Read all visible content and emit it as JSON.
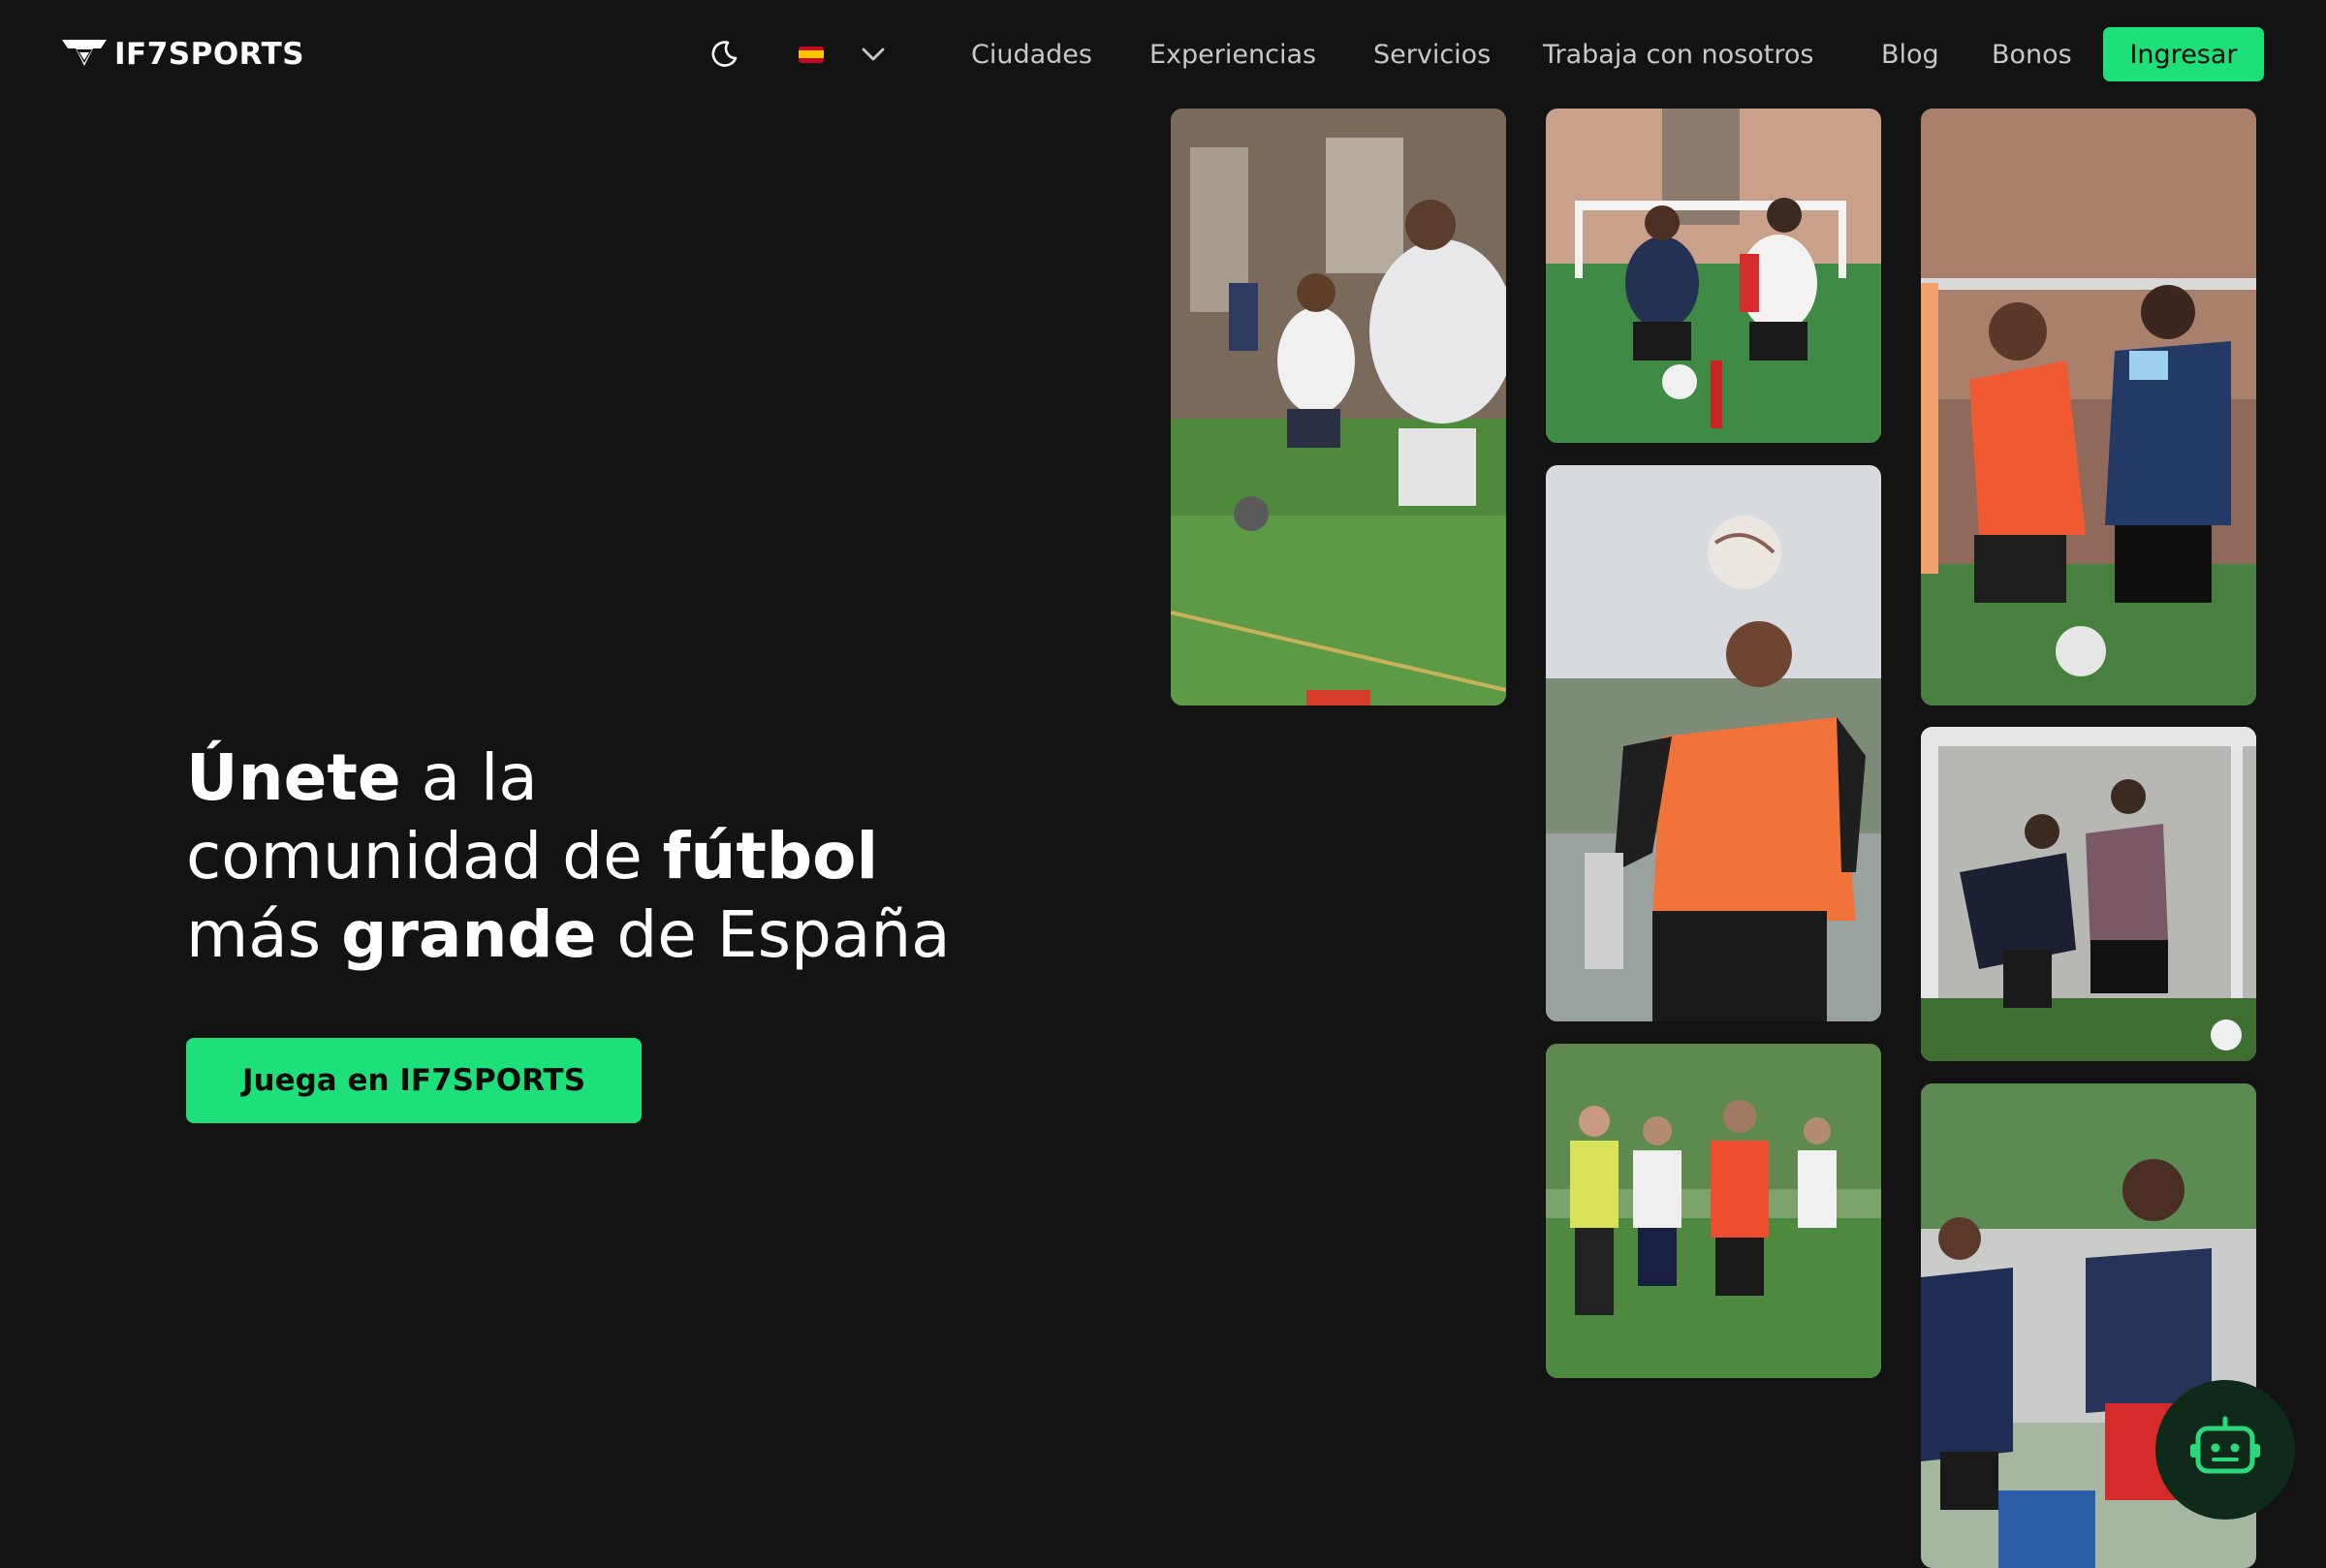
{
  "header": {
    "brand": "IF7SPORTS",
    "theme_icon": "moon-icon",
    "language": {
      "flag": "spain-flag-icon",
      "dropdown_icon": "chevron-down-icon"
    },
    "nav": [
      {
        "label": "Ciudades"
      },
      {
        "label": "Experiencias"
      },
      {
        "label": "Servicios"
      },
      {
        "label": "Trabaja con nosotros"
      },
      {
        "label": "Blog"
      },
      {
        "label": "Bonos"
      }
    ],
    "login_label": "Ingresar"
  },
  "hero": {
    "title_line1_bold": "Únete",
    "title_line1_rest": " a la",
    "title_line2_start": "comunidad de ",
    "title_line2_bold": "fútbol",
    "title_line3_start": "más ",
    "title_line3_bold": "grande",
    "title_line3_rest": " de España",
    "cta_label": "Juega en IF7SPORTS"
  },
  "gallery": {
    "photos": [
      {
        "name": "photo-players-dribbling",
        "icon": "football-photo"
      },
      {
        "name": "photo-tackle-match",
        "icon": "football-photo"
      },
      {
        "name": "photo-players-duel",
        "icon": "football-photo"
      },
      {
        "name": "photo-header-orange-bib",
        "icon": "football-photo"
      },
      {
        "name": "photo-goalkeeper-shot",
        "icon": "football-photo"
      },
      {
        "name": "photo-team-briefing",
        "icon": "football-photo"
      },
      {
        "name": "photo-player-running",
        "icon": "football-photo"
      }
    ]
  },
  "chat": {
    "icon": "robot-icon"
  },
  "colors": {
    "background": "#131313",
    "accent": "#1ee07a",
    "nav_text": "#c8c8c8",
    "text": "#ffffff"
  }
}
